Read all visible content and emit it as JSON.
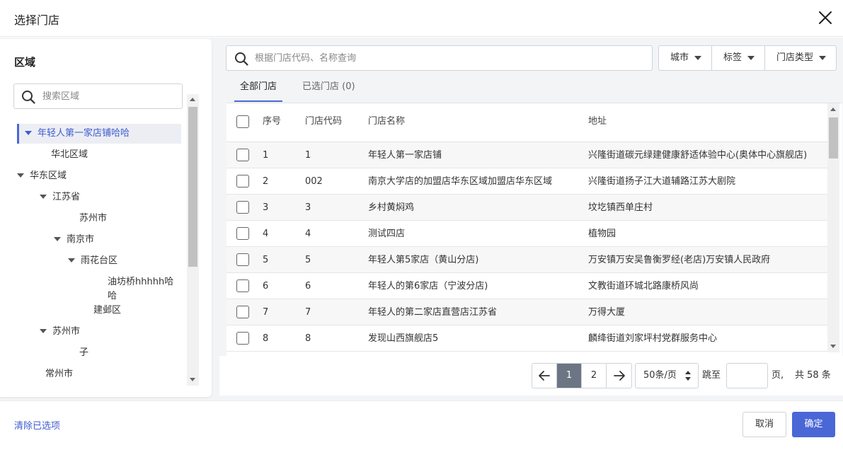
{
  "dialog": {
    "title": "选择门店"
  },
  "region": {
    "title": "区域",
    "search_placeholder": "搜索区域",
    "tree": [
      {
        "label": "年轻人第一家店铺哈哈",
        "level": 0,
        "expanded": true,
        "selected": true
      },
      {
        "label": "华北区域",
        "level": 1,
        "expanded": false
      },
      {
        "label": "华东区域",
        "level": 1,
        "expanded": true
      },
      {
        "label": "江苏省",
        "level": 2,
        "expanded": true
      },
      {
        "label": "苏州市",
        "level": 3,
        "expanded": false
      },
      {
        "label": "南京市",
        "level": 3,
        "expanded": true
      },
      {
        "label": "雨花台区",
        "level": 4,
        "expanded": true
      },
      {
        "label": "油坊桥hhhhh哈哈",
        "level": 5,
        "expanded": false
      },
      {
        "label": "建邺区",
        "level": 4,
        "expanded": false
      },
      {
        "label": "苏州市",
        "level": 2,
        "expanded": true
      },
      {
        "label": "子",
        "level": 3,
        "expanded": false
      },
      {
        "label": "常州市",
        "level": 2,
        "expanded": false
      }
    ]
  },
  "search": {
    "placeholder": "根据门店代码、名称查询"
  },
  "filters": [
    "城市",
    "标签",
    "门店类型"
  ],
  "tabs": [
    {
      "label": "全部门店",
      "active": true
    },
    {
      "label": "已选门店 (0)",
      "active": false
    }
  ],
  "table": {
    "columns": [
      "序号",
      "门店代码",
      "门店名称",
      "地址"
    ],
    "rows": [
      {
        "index": "1",
        "code": "1",
        "name": "年轻人第一家店铺",
        "address": "兴隆街道碳元绿建健康舒适体验中心(奥体中心旗舰店)"
      },
      {
        "index": "2",
        "code": "002",
        "name": "南京大学店的加盟店华东区域加盟店华东区域",
        "address": "兴隆街道扬子江大道辅路江苏大剧院"
      },
      {
        "index": "3",
        "code": "3",
        "name": "乡村黄焖鸡",
        "address": "坟圪镇西单庄村"
      },
      {
        "index": "4",
        "code": "4",
        "name": "测试四店",
        "address": "植物园"
      },
      {
        "index": "5",
        "code": "5",
        "name": "年轻人第5家店（黄山分店)",
        "address": "万安镇万安吴鲁衡罗经(老店)万安镇人民政府"
      },
      {
        "index": "6",
        "code": "6",
        "name": "年轻人的第6家店（宁波分店)",
        "address": "文教街道环城北路康桥风尚"
      },
      {
        "index": "7",
        "code": "7",
        "name": "年轻人的第二家店直营店江苏省",
        "address": "万得大厦"
      },
      {
        "index": "8",
        "code": "8",
        "name": "发现山西旗舰店5",
        "address": "麟绛街道刘家坪村党群服务中心"
      }
    ]
  },
  "pagination": {
    "pages": [
      "1",
      "2"
    ],
    "current": "1",
    "page_size": "50条/页",
    "jump_label": "跳至",
    "page_unit": "页,",
    "total": "共 58 条"
  },
  "footer": {
    "clear_label": "清除已选项",
    "cancel_label": "取消",
    "confirm_label": "确定"
  },
  "colors": {
    "accent": "#4a67d6",
    "active_page": "#6c7583"
  }
}
